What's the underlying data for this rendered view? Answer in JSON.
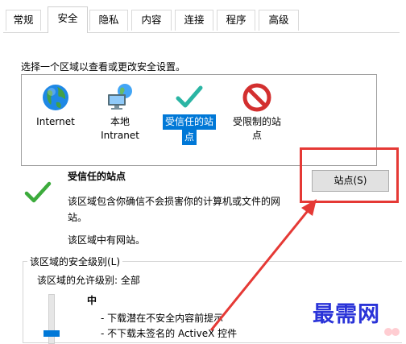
{
  "tabs": [
    {
      "label": "常规"
    },
    {
      "label": "安全"
    },
    {
      "label": "隐私"
    },
    {
      "label": "内容"
    },
    {
      "label": "连接"
    },
    {
      "label": "程序"
    },
    {
      "label": "高级"
    }
  ],
  "active_tab": "安全",
  "instructions": "选择一个区域以查看或更改安全设置。",
  "zones": [
    {
      "label_line1": "Internet",
      "label_line2": "",
      "icon": "globe-icon"
    },
    {
      "label_line1": "本地",
      "label_line2": "Intranet",
      "icon": "computer-network-icon"
    },
    {
      "label_line1": "受信任的站",
      "label_line2": "点",
      "icon": "checkmark-icon",
      "selected": true
    },
    {
      "label_line1": "受限制的站",
      "label_line2": "点",
      "icon": "prohibited-icon"
    }
  ],
  "zone_detail": {
    "title": "受信任的站点",
    "description_line1": "该区域包含你确信不会损害你的计算机或文件的网",
    "description_line2": "站。",
    "note": "该区域中有网站。",
    "sites_button": "站点(S)"
  },
  "security_level": {
    "group_label": "该区域的安全级别(L)",
    "allowed": "该区域的允许级别: 全部",
    "level_name": "中",
    "bullets": [
      "- 下载潜在不安全内容前提示",
      "- 不下载未签名的 ActiveX 控件"
    ]
  },
  "watermark": "最需网",
  "colors": {
    "selection": "#0078d7",
    "highlight_red": "#e53935",
    "watermark": "#2a33d8"
  }
}
